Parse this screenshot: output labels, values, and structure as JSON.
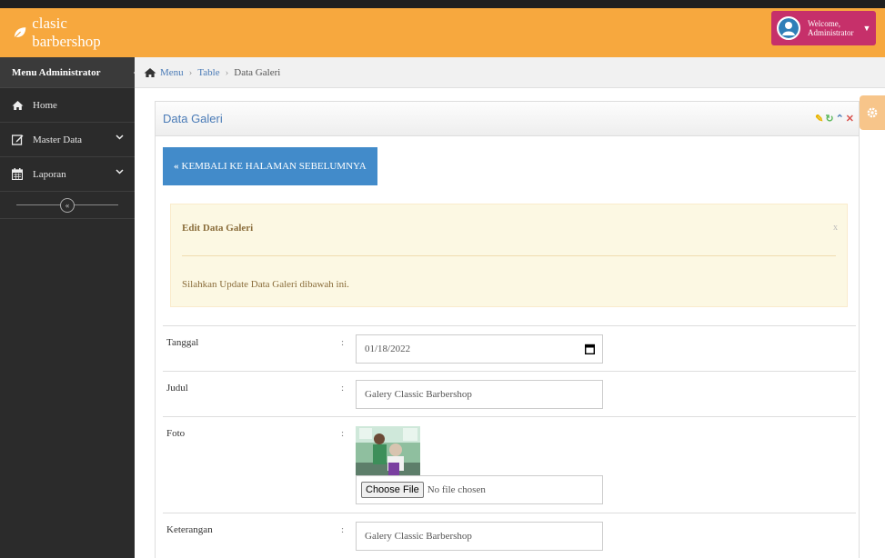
{
  "brand": {
    "name": "clasic barbershop"
  },
  "user": {
    "welcome": "Welcome,",
    "name": "Administrator"
  },
  "sidebar": {
    "header": "Menu Administrator",
    "items": [
      {
        "label": "Home",
        "icon": "home-icon"
      },
      {
        "label": "Master Data",
        "icon": "edit-icon"
      },
      {
        "label": "Laporan",
        "icon": "calendar-icon"
      }
    ]
  },
  "breadcrumb": {
    "items": [
      "Menu",
      "Table",
      "Data Galeri"
    ]
  },
  "panel": {
    "title": "Data Galeri"
  },
  "back_button": {
    "label": "KEMBALI KE HALAMAN SEBELUMNYA"
  },
  "alert": {
    "title": "Edit Data Galeri",
    "close": "x",
    "message": "Silahkan Update Data Galeri dibawah ini."
  },
  "form": {
    "colon": ":",
    "tanggal": {
      "label": "Tanggal",
      "value": "01/18/2022"
    },
    "judul": {
      "label": "Judul",
      "value": "Galery Classic Barbershop"
    },
    "foto": {
      "label": "Foto",
      "button": "Choose File",
      "status": "No file chosen"
    },
    "keterangan": {
      "label": "Keterangan",
      "value": "Galery Classic Barbershop"
    }
  },
  "colors": {
    "navbar": "#f7a83e",
    "user_box": "#c6306a",
    "sidebar": "#2b2b2b",
    "primary": "#428bca",
    "alert_bg": "#fcf8e3"
  }
}
